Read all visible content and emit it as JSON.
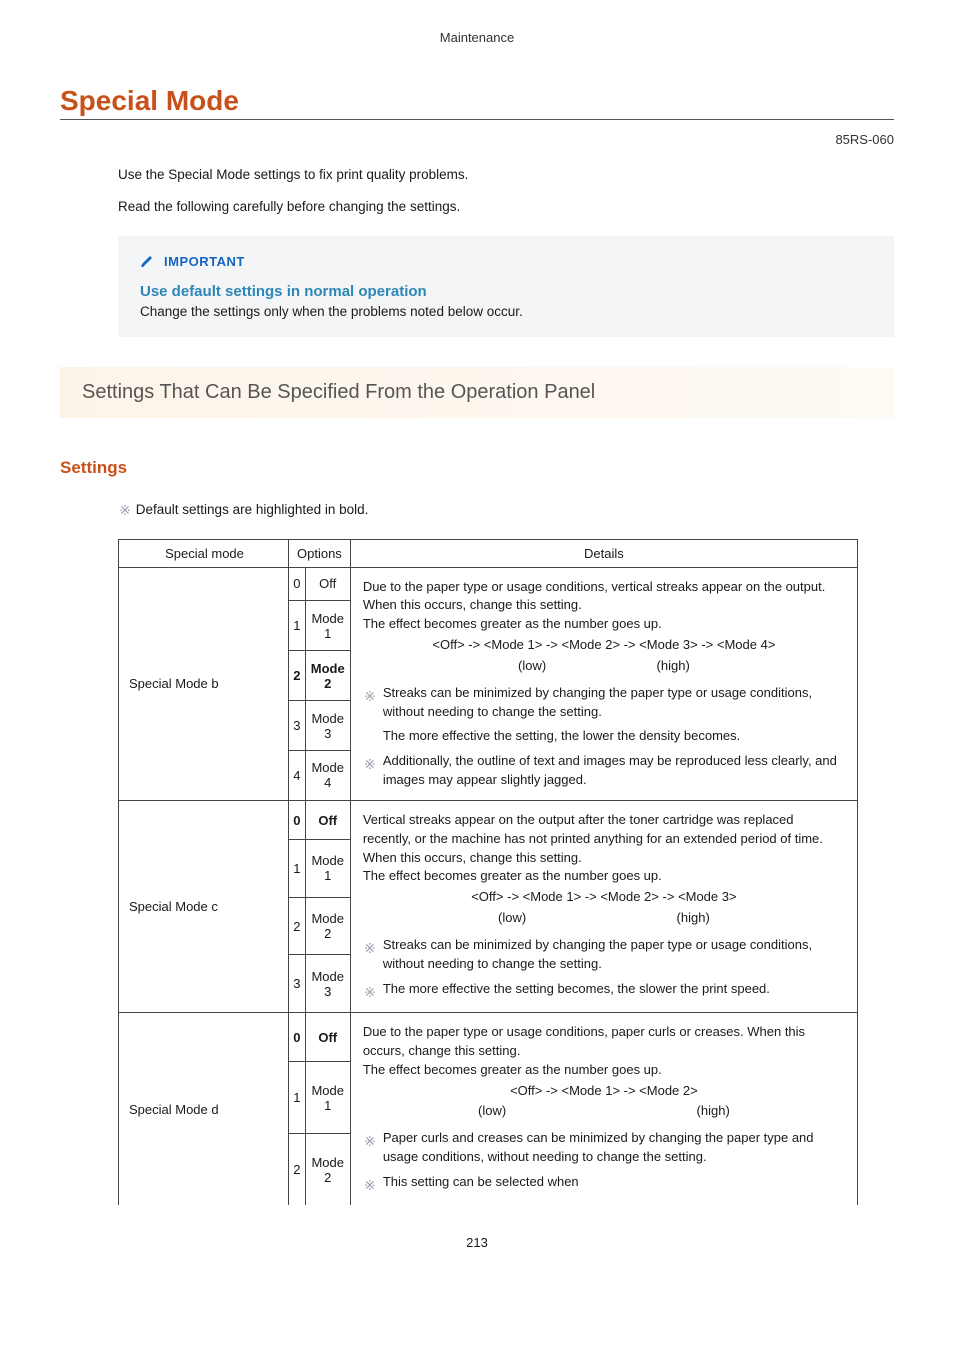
{
  "breadcrumb": "Maintenance",
  "title": "Special Mode",
  "doc_id": "85RS-060",
  "intro": {
    "p1": "Use the Special Mode settings to fix print quality problems.",
    "p2": "Read the following carefully before changing the settings."
  },
  "important": {
    "label": "IMPORTANT",
    "heading": "Use default settings in normal operation",
    "text": "Change the settings only when the problems noted below occur."
  },
  "panel_heading": "Settings That Can Be Specified From the Operation Panel",
  "settings_heading": "Settings",
  "bold_note": "Default settings are highlighted in bold.",
  "table": {
    "headers": {
      "mode": "Special mode",
      "options": "Options",
      "details": "Details"
    },
    "rows": [
      {
        "name": "Special Mode b",
        "options": [
          {
            "num": "0",
            "label": "Off",
            "bold": false
          },
          {
            "num": "1",
            "label": "Mode 1",
            "bold": false
          },
          {
            "num": "2",
            "label": "Mode 2",
            "bold": true
          },
          {
            "num": "3",
            "label": "Mode 3",
            "bold": false
          },
          {
            "num": "4",
            "label": "Mode 4",
            "bold": false
          }
        ],
        "details": {
          "lead": "Due to the paper type or usage conditions, vertical streaks appear on the output. When this occurs, change this setting.",
          "effect": "The effect becomes greater as the number goes up.",
          "seq": "<Off> -> <Mode 1> -> <Mode 2> -> <Mode 3> -> <Mode 4>",
          "low": "(low)",
          "high": "(high)",
          "notes": [
            "Streaks can be minimized by changing the paper type or usage conditions, without needing to change the setting.",
            "The more effective the setting, the lower the density becomes.",
            "Additionally, the outline of text and images may be reproduced less clearly, and images may appear slightly jagged."
          ]
        }
      },
      {
        "name": "Special Mode c",
        "options": [
          {
            "num": "0",
            "label": "Off",
            "bold": true
          },
          {
            "num": "1",
            "label": "Mode 1",
            "bold": false
          },
          {
            "num": "2",
            "label": "Mode 2",
            "bold": false
          },
          {
            "num": "3",
            "label": "Mode 3",
            "bold": false
          }
        ],
        "details": {
          "lead": "Vertical streaks appear on the output after the toner cartridge was replaced recently, or the machine has not printed anything for an extended period of time. When this occurs, change this setting.",
          "effect": "The effect becomes greater as the number goes up.",
          "seq": "<Off> -> <Mode 1> -> <Mode 2> -> <Mode 3>",
          "low": "(low)",
          "high": "(high)",
          "notes": [
            "Streaks can be minimized by changing the paper type or usage conditions, without needing to change the setting.",
            "The more effective the setting becomes, the slower the print speed."
          ]
        }
      },
      {
        "name": "Special Mode d",
        "options": [
          {
            "num": "0",
            "label": "Off",
            "bold": true
          },
          {
            "num": "1",
            "label": "Mode 1",
            "bold": false
          },
          {
            "num": "2",
            "label": "Mode 2",
            "bold": false
          }
        ],
        "details": {
          "lead": "Due to the paper type or usage conditions, paper curls or creases. When this occurs, change this setting.",
          "effect": "The effect becomes greater as the number goes up.",
          "seq": "<Off> -> <Mode 1> -> <Mode 2>",
          "low": "(low)",
          "high": "(high)",
          "notes": [
            "Paper curls and creases can be minimized by changing the paper type and usage conditions, without needing to change the setting.",
            "This setting can be selected when"
          ]
        }
      }
    ]
  },
  "page_number": "213"
}
